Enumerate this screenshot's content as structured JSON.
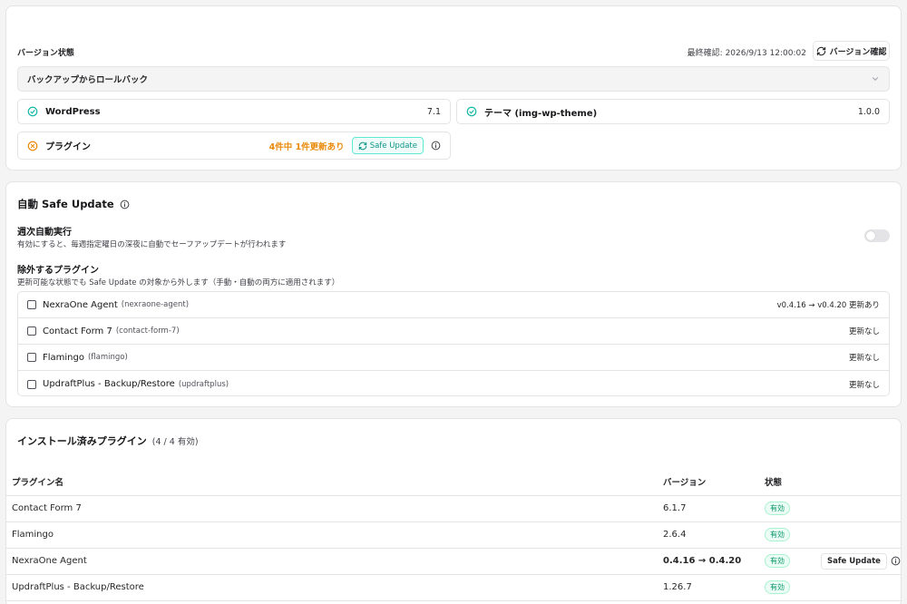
{
  "version_section": {
    "title": "バージョン状態",
    "last_check": "最終確認: 2026/9/13 12:00:02",
    "check_button": "バージョン確認",
    "rollback_label": "バックアップからロールバック",
    "wordpress": {
      "label": "WordPress",
      "value": "7.1"
    },
    "theme": {
      "label": "テーマ (img-wp-theme)",
      "value": "1.0.0"
    },
    "plugins": {
      "label": "プラグイン",
      "value": "4件中 1件更新あり",
      "safe_update_button": "Safe Update"
    }
  },
  "auto_section": {
    "title": "自動 Safe Update",
    "weekly_title": "週次自動実行",
    "weekly_desc": "有効にすると、毎週指定曜日の深夜に自動でセーフアップデートが行われます",
    "weekly_enabled": false,
    "exclude_title": "除外するプラグイン",
    "exclude_desc": "更新可能な状態でも Safe Update の対象から外します（手動・自動の両方に適用されます）",
    "exclude_list": [
      {
        "name": "NexraOne Agent",
        "slug": "(nexraone-agent)",
        "status": "v0.4.16 → v0.4.20 更新あり",
        "checked": false
      },
      {
        "name": "Contact Form 7",
        "slug": "(contact-form-7)",
        "status": "更新なし",
        "checked": false
      },
      {
        "name": "Flamingo",
        "slug": "(flamingo)",
        "status": "更新なし",
        "checked": false
      },
      {
        "name": "UpdraftPlus - Backup/Restore",
        "slug": "(updraftplus)",
        "status": "更新なし",
        "checked": false
      }
    ]
  },
  "installed_section": {
    "title": "インストール済みプラグイン",
    "count": "(4 / 4 有効)",
    "columns": {
      "name": "プラグイン名",
      "version": "バージョン",
      "status": "状態"
    },
    "rows": [
      {
        "name": "Contact Form 7",
        "version": "6.1.7",
        "status": "有効",
        "update": false
      },
      {
        "name": "Flamingo",
        "version": "2.6.4",
        "status": "有効",
        "update": false
      },
      {
        "name": "NexraOne Agent",
        "version": "0.4.16 → 0.4.20",
        "status": "有効",
        "update": true,
        "action": "Safe Update"
      },
      {
        "name": "UpdraftPlus - Backup/Restore",
        "version": "1.26.7",
        "status": "有効",
        "update": false
      }
    ]
  },
  "colors": {
    "accent_teal": "#14b8a6",
    "warning_orange": "#ea8a0a",
    "success_green": "#059669"
  }
}
